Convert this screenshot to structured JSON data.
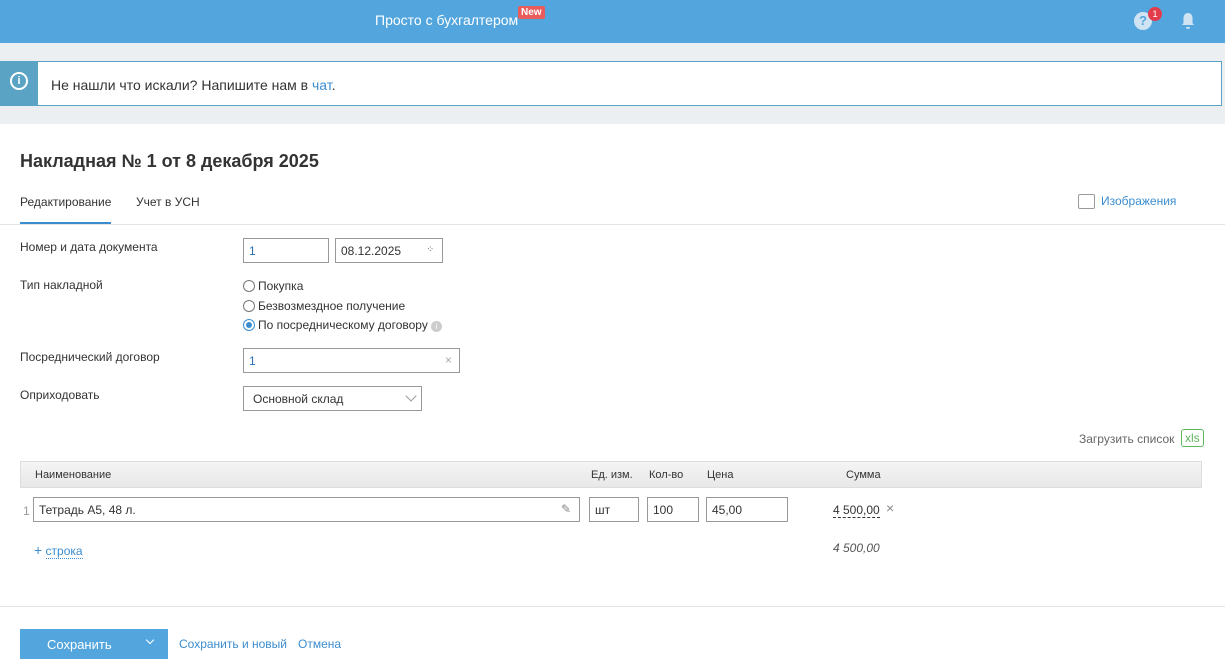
{
  "header": {
    "brand": "Просто с бухгалтером",
    "new_badge": "New",
    "help_badge": "1"
  },
  "notice": {
    "text": "Не нашли что искали? Напишите нам в ",
    "link": "чат",
    "tail": "."
  },
  "doc": {
    "title": "Накладная № 1 от 8 декабря 2025",
    "tabs": [
      "Редактирование",
      "Учет в УСН"
    ],
    "images_label": "Изображения",
    "number_label": "Номер и дата документа",
    "number": "1",
    "date": "08.12.2025",
    "type_label": "Тип накладной",
    "types": [
      "Покупка",
      "Безвозмездное получение",
      "По посредническому договору"
    ],
    "contract_label": "Посреднический договор",
    "contract": "1",
    "store_label": "Оприходовать",
    "store": "Основной склад"
  },
  "table": {
    "upload_label": "Загрузить список",
    "xls": "xls",
    "headers": [
      "Наименование",
      "Ед. изм.",
      "Кол-во",
      "Цена",
      "Сумма"
    ],
    "rows": [
      {
        "n": "1",
        "name": "Тетрадь А5, 48 л.",
        "unit": "шт",
        "qty": "100",
        "price": "45,00",
        "sum": "4 500,00"
      }
    ],
    "add_row": "строка",
    "total": "4 500,00"
  },
  "footer": {
    "save": "Сохранить",
    "save_new": "Сохранить и новый",
    "cancel": "Отмена"
  }
}
